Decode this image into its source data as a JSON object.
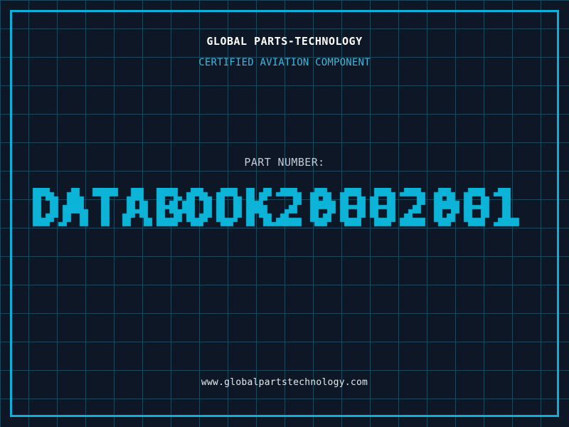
{
  "header": {
    "title": "GLOBAL PARTS-TECHNOLOGY",
    "subtitle": "CERTIFIED AVIATION COMPONENT"
  },
  "part": {
    "label": "PART NUMBER:",
    "number": "DATABOOK20002001"
  },
  "footer": {
    "website": "www.globalpartstechnology.com"
  },
  "colors": {
    "background": "#0e1726",
    "grid_line": "#1b485c",
    "frame_cyan": "#0cb0d8",
    "part_number_cyan": "#0db4d8",
    "subtitle_cyan": "#41b6d9",
    "title_white": "#ffffff",
    "label_gray": "#c2cbd4",
    "footer_white": "#e2e9ee"
  }
}
